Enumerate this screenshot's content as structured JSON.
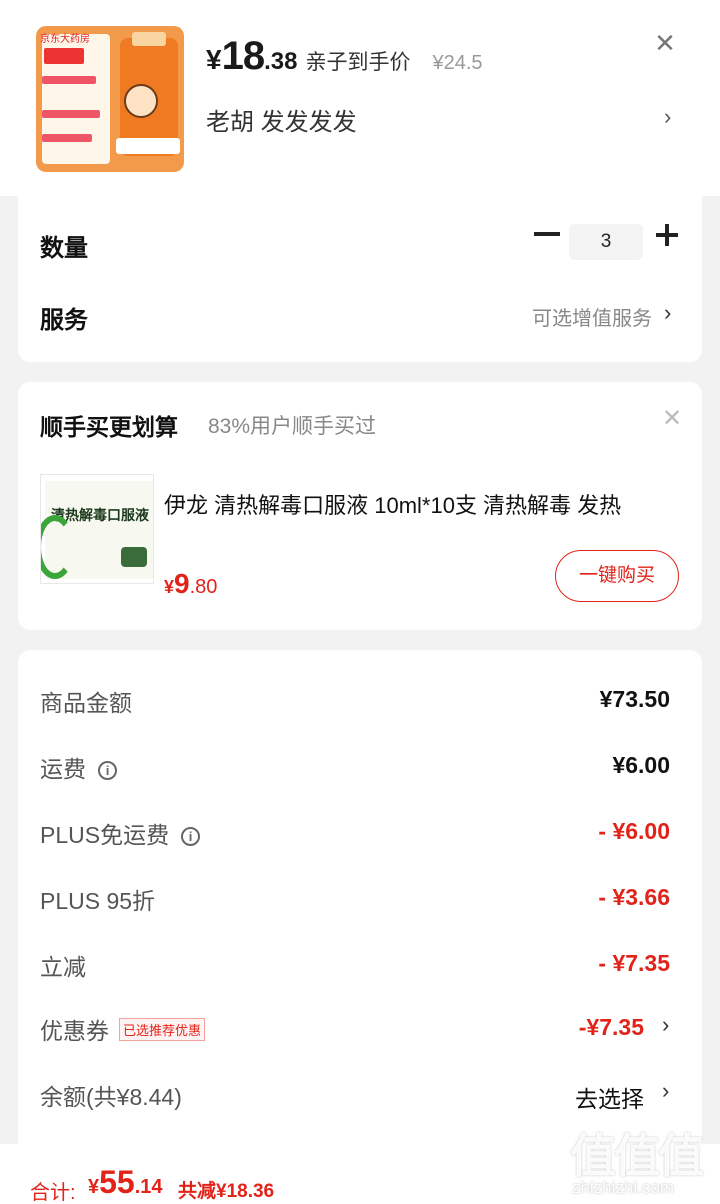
{
  "product": {
    "thumb_store": "京东大药房",
    "price_yen": "¥",
    "price_int": "18",
    "price_dec": ".38",
    "price_label": "亲子到手价",
    "orig_price": "¥24.5",
    "spec": "老胡  发发发发"
  },
  "quantity": {
    "label": "数量",
    "value": "3"
  },
  "service": {
    "label": "服务",
    "value": "可选增值服务"
  },
  "addon": {
    "title": "顺手买更划算",
    "subtitle": "83%用户顺手买过",
    "product_box_title": "清热解毒口服液",
    "product_name": "伊龙 清热解毒口服液 10ml*10支 清热解毒  发热",
    "price_yen": "¥",
    "price_int": "9",
    "price_dec": ".80",
    "buy_label": "一键购买"
  },
  "fees": [
    {
      "label": "商品金额",
      "value": "¥73.50"
    },
    {
      "label": "运费",
      "value": "¥6.00"
    },
    {
      "label": "PLUS免运费",
      "value": "- ¥6.00"
    },
    {
      "label": "PLUS 95折",
      "value": "- ¥3.66"
    },
    {
      "label": "立减",
      "value": "- ¥7.35"
    },
    {
      "label": "优惠券",
      "tag": "已选推荐优惠",
      "value": "-¥7.35"
    },
    {
      "label": "余额(共¥8.44)",
      "value": "去选择"
    }
  ],
  "footer": {
    "total_label": "合计:",
    "total_yen": "¥",
    "total_int": "55",
    "total_dec": ".14",
    "save_text": "共减¥18.36"
  },
  "watermark": {
    "chars": "值值值",
    "url": "zhizhizhi.com"
  },
  "colors": {
    "accent": "#e2231a",
    "background": "#f2f2f2"
  }
}
